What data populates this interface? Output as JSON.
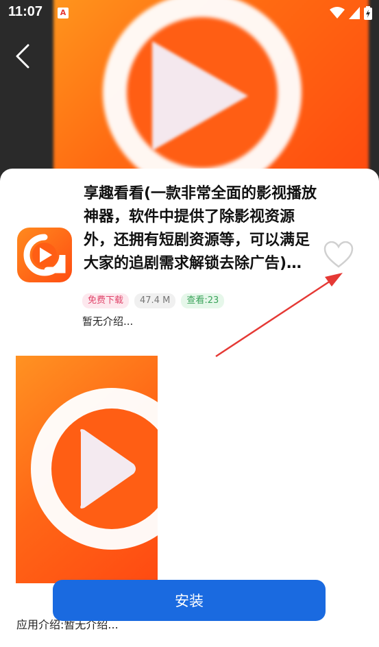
{
  "status_bar": {
    "time": "11:07",
    "notification_icon": "A"
  },
  "app": {
    "title": "享趣看看(一款非常全面的影视播放神器，软件中提供了除影视资源外，还拥有短剧资源等，可以满足大家的追剧需求解锁去除广告)…",
    "tags": {
      "free": "免费下载",
      "size": "47.4 M",
      "views": "查看:23"
    },
    "short_desc": "暂无介绍..."
  },
  "install_label": "安装",
  "intro_text": "应用介绍:暂无介绍...",
  "colors": {
    "accent": "#1a6ae0",
    "annotation_arrow": "#e53935",
    "brand_orange": "#ff5e14"
  }
}
